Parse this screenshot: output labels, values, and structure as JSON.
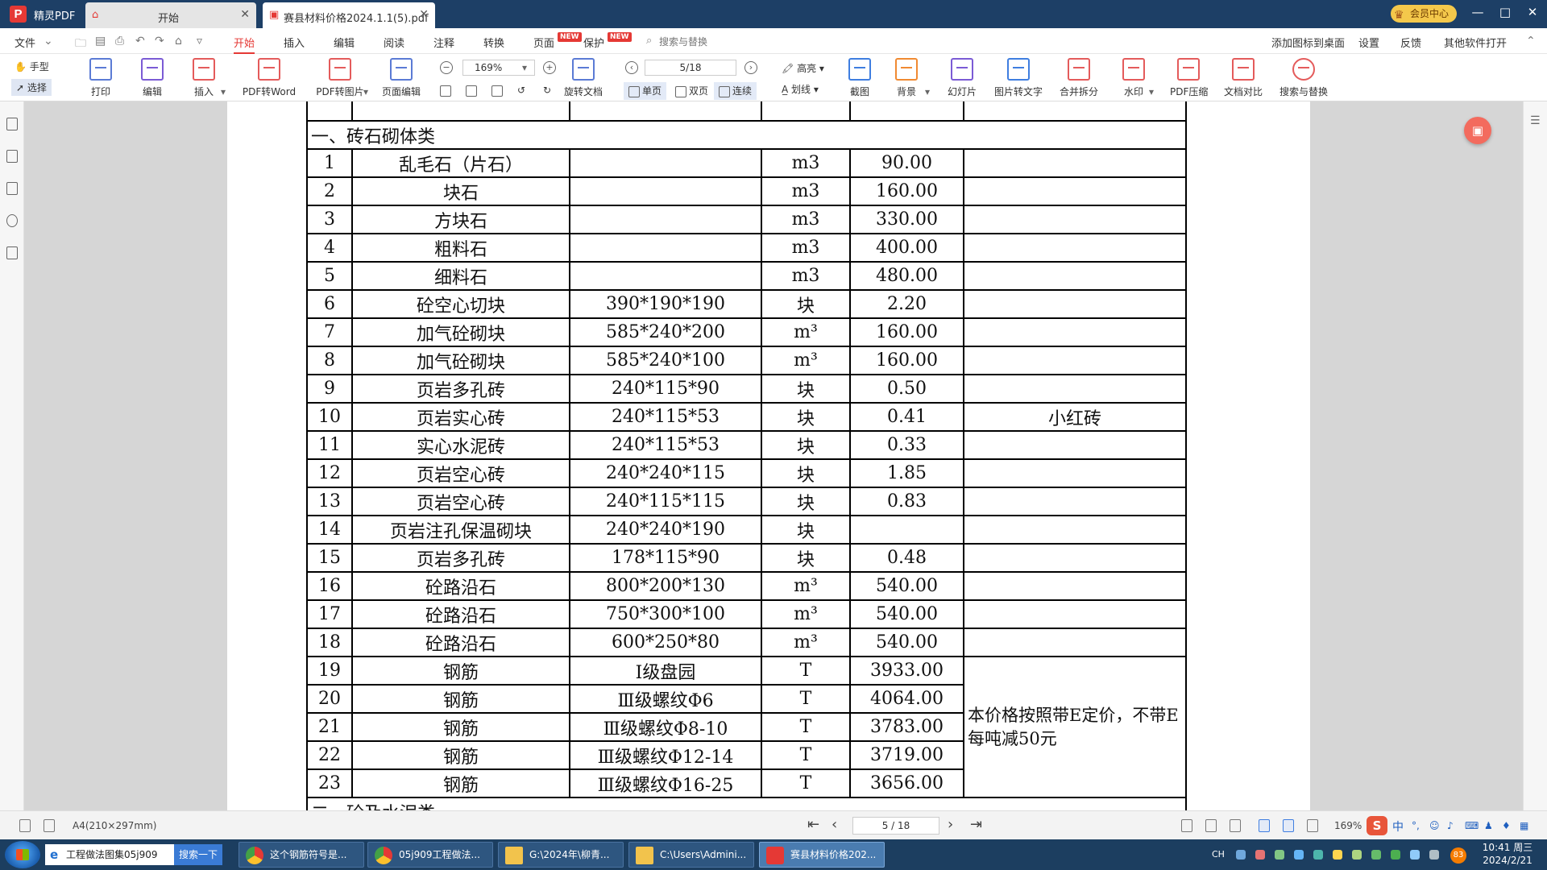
{
  "app": {
    "logo": "P",
    "name": "精灵PDF"
  },
  "tabs": [
    {
      "label": "开始",
      "icon": "home-icon"
    },
    {
      "label": "赛县材料价格2024.1.1(5).pdf",
      "icon": "pdf-file-icon"
    }
  ],
  "titlebar": {
    "vip_label": "会员中心",
    "vip_icon_text": "VIP"
  },
  "menu": {
    "file": "文件",
    "items": [
      "开始",
      "插入",
      "编辑",
      "阅读",
      "注释",
      "转换",
      "页面",
      "保护"
    ],
    "new_tag": "NEW",
    "search_placeholder": "搜索与替换",
    "right_items": [
      "添加图标到桌面",
      "设置",
      "反馈",
      "其他软件打开"
    ]
  },
  "toolbar": {
    "hand": "手型",
    "select": "选择",
    "print": "打印",
    "edit": "编辑",
    "insert": "插入",
    "pdf_to_word": "PDF转Word",
    "pdf_to_image": "PDF转图片",
    "page_edit": "页面编辑",
    "zoom": "169%",
    "rotate_doc": "旋转文档",
    "page_field": "5/18",
    "single_page": "单页",
    "double_page": "双页",
    "continuous": "连续",
    "highlight": "高亮",
    "strikethrough": "划线",
    "screenshot": "截图",
    "background": "背景",
    "slideshow": "幻灯片",
    "image_to_text": "图片转文字",
    "merge_split": "合并拆分",
    "watermark": "水印",
    "pdf_compress": "PDF压缩",
    "doc_compare": "文档对比",
    "search_replace": "搜索与替换"
  },
  "document": {
    "section1": "一、砖石砌体类",
    "section2": "二、砼及水泥类",
    "rows": [
      {
        "no": "1",
        "name": "乱毛石（片石）",
        "spec": "",
        "unit": "m3",
        "price": "90.00",
        "note": ""
      },
      {
        "no": "2",
        "name": "块石",
        "spec": "",
        "unit": "m3",
        "price": "160.00",
        "note": ""
      },
      {
        "no": "3",
        "name": "方块石",
        "spec": "",
        "unit": "m3",
        "price": "330.00",
        "note": ""
      },
      {
        "no": "4",
        "name": "粗料石",
        "spec": "",
        "unit": "m3",
        "price": "400.00",
        "note": ""
      },
      {
        "no": "5",
        "name": "细料石",
        "spec": "",
        "unit": "m3",
        "price": "480.00",
        "note": ""
      },
      {
        "no": "6",
        "name": "砼空心切块",
        "spec": "390*190*190",
        "unit": "块",
        "price": "2.20",
        "note": ""
      },
      {
        "no": "7",
        "name": "加气砼砌块",
        "spec": "585*240*200",
        "unit": "m³",
        "price": "160.00",
        "note": ""
      },
      {
        "no": "8",
        "name": "加气砼砌块",
        "spec": "585*240*100",
        "unit": "m³",
        "price": "160.00",
        "note": ""
      },
      {
        "no": "9",
        "name": "页岩多孔砖",
        "spec": "240*115*90",
        "unit": "块",
        "price": "0.50",
        "note": ""
      },
      {
        "no": "10",
        "name": "页岩实心砖",
        "spec": "240*115*53",
        "unit": "块",
        "price": "0.41",
        "note": "小红砖"
      },
      {
        "no": "11",
        "name": "实心水泥砖",
        "spec": "240*115*53",
        "unit": "块",
        "price": "0.33",
        "note": ""
      },
      {
        "no": "12",
        "name": "页岩空心砖",
        "spec": "240*240*115",
        "unit": "块",
        "price": "1.85",
        "note": ""
      },
      {
        "no": "13",
        "name": "页岩空心砖",
        "spec": "240*115*115",
        "unit": "块",
        "price": "0.83",
        "note": ""
      },
      {
        "no": "14",
        "name": "页岩注孔保温砌块",
        "spec": "240*240*190",
        "unit": "块",
        "price": "",
        "note": ""
      },
      {
        "no": "15",
        "name": "页岩多孔砖",
        "spec": "178*115*90",
        "unit": "块",
        "price": "0.48",
        "note": ""
      },
      {
        "no": "16",
        "name": "砼路沿石",
        "spec": "800*200*130",
        "unit": "m³",
        "price": "540.00",
        "note": ""
      },
      {
        "no": "17",
        "name": "砼路沿石",
        "spec": "750*300*100",
        "unit": "m³",
        "price": "540.00",
        "note": ""
      },
      {
        "no": "18",
        "name": "砼路沿石",
        "spec": "600*250*80",
        "unit": "m³",
        "price": "540.00",
        "note": ""
      },
      {
        "no": "19",
        "name": "钢筋",
        "spec": "Ⅰ级盘园",
        "unit": "T",
        "price": "3933.00",
        "note": ""
      },
      {
        "no": "20",
        "name": "钢筋",
        "spec": "Ⅲ级螺纹Φ6",
        "unit": "T",
        "price": "4064.00",
        "note": ""
      },
      {
        "no": "21",
        "name": "钢筋",
        "spec": "Ⅲ级螺纹Φ8-10",
        "unit": "T",
        "price": "3783.00",
        "note": ""
      },
      {
        "no": "22",
        "name": "钢筋",
        "spec": "Ⅲ级螺纹Φ12-14",
        "unit": "T",
        "price": "3719.00",
        "note": ""
      },
      {
        "no": "23",
        "name": "钢筋",
        "spec": "Ⅲ级螺纹Φ16-25",
        "unit": "T",
        "price": "3656.00",
        "note": ""
      }
    ],
    "rebar_note": "本价格按照带E定价，不带E每吨减50元"
  },
  "statusbar": {
    "page_size": "A4(210×297mm)",
    "page_field": "5 / 18",
    "zoom": "169%"
  },
  "taskbar": {
    "ie_text": "工程做法图集05j909",
    "search_button": "搜索一下",
    "tasks": [
      "这个钢筋符号是...",
      "05j909工程做法...",
      "G:\\2024年\\柳青...",
      "C:\\Users\\Admini...",
      "赛县材料价格202..."
    ],
    "tray_lang": "CH",
    "ime_label": "中",
    "clock_time": "10:41 周三",
    "clock_date": "2024/2/21",
    "badge": "83"
  }
}
